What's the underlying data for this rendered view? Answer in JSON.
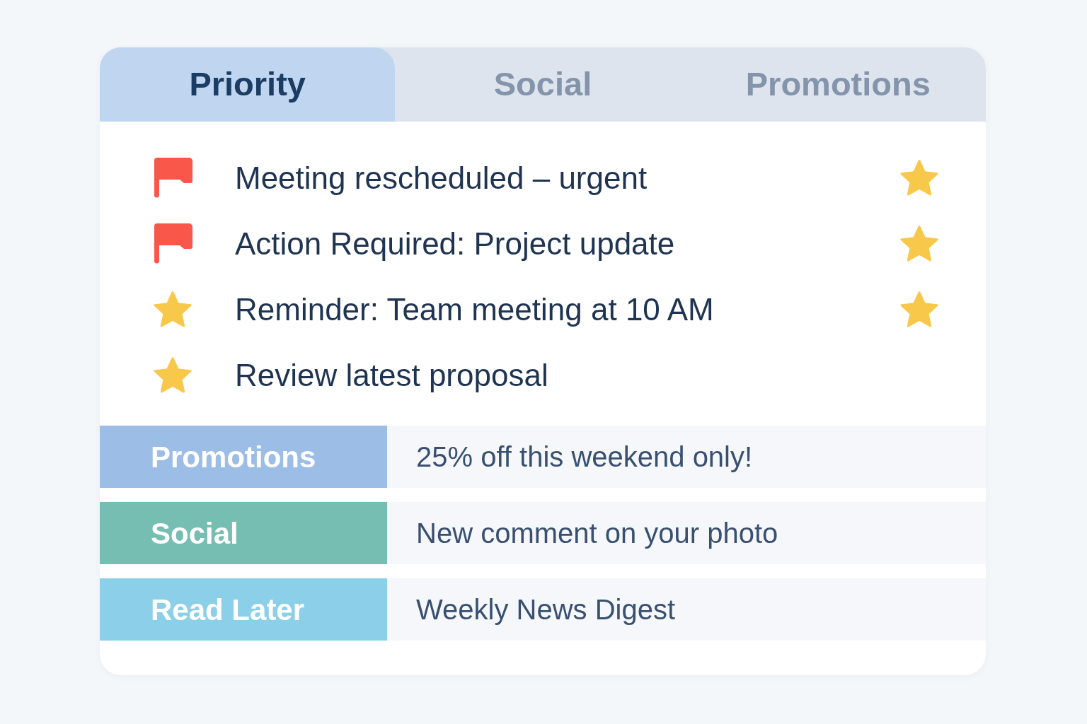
{
  "tabs": [
    {
      "label": "Priority",
      "selected": true
    },
    {
      "label": "Social",
      "selected": false
    },
    {
      "label": "Promotions",
      "selected": false
    }
  ],
  "messages": [
    {
      "kind": "flag",
      "subject": "Meeting rescheduled – urgent",
      "starred": true
    },
    {
      "kind": "flag",
      "subject": "Action Required: Project update",
      "starred": true
    },
    {
      "kind": "star",
      "subject": "Reminder: Team meeting at 10 AM",
      "starred": true
    },
    {
      "kind": "star",
      "subject": "Review latest proposal",
      "starred": false
    }
  ],
  "categories": [
    {
      "label": "Promotions",
      "color": "#9bbde6",
      "preview": "25% off this weekend only!"
    },
    {
      "label": "Social",
      "color": "#76bdb2",
      "preview": "New comment on your photo"
    },
    {
      "label": "Read Later",
      "color": "#8ccfe9",
      "preview": "Weekly News Digest"
    }
  ]
}
